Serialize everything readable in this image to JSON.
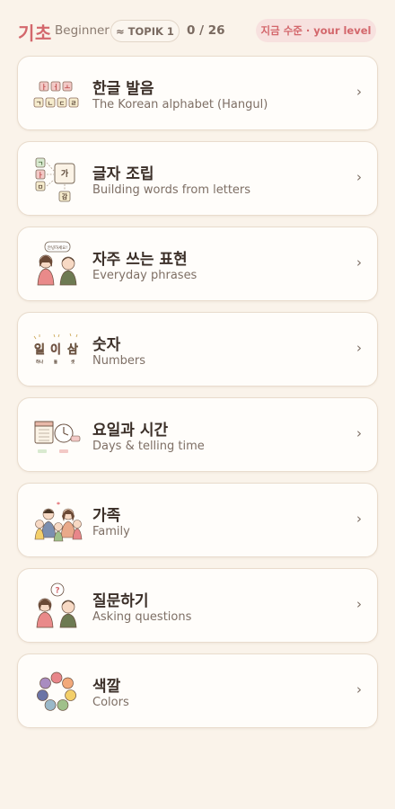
{
  "header": {
    "title": "기초",
    "subtitle": "Beginner",
    "badge": "≈ TOPIK 1",
    "progress": "0 / 26",
    "level_button": "지금 수준 · your level"
  },
  "chevron": "›",
  "lessons": [
    {
      "title_ko": "한글 발음",
      "title_en": "The Korean alphabet (Hangul)",
      "icon": "hangul-tiles-icon"
    },
    {
      "title_ko": "글자 조립",
      "title_en": "Building words from letters",
      "icon": "letter-assembly-icon"
    },
    {
      "title_ko": "자주 쓰는 표현",
      "title_en": "Everyday phrases",
      "icon": "greeting-people-icon"
    },
    {
      "title_ko": "숫자",
      "title_en": "Numbers",
      "icon": "numbers-icon"
    },
    {
      "title_ko": "요일과 시간",
      "title_en": "Days & telling time",
      "icon": "calendar-clock-icon"
    },
    {
      "title_ko": "가족",
      "title_en": "Family",
      "icon": "family-icon"
    },
    {
      "title_ko": "질문하기",
      "title_en": "Asking questions",
      "icon": "question-people-icon"
    },
    {
      "title_ko": "색깔",
      "title_en": "Colors",
      "icon": "color-palette-icon"
    }
  ],
  "illustration_text": {
    "hangul_top": [
      "ㅏ",
      "ㅓ",
      "ㅗ"
    ],
    "hangul_bottom": [
      "ㄱ",
      "ㄴ",
      "ㄷ",
      "ㄹ"
    ],
    "assembly_tiles": [
      "ㄱ",
      "ㅏ",
      "ㅁ",
      "가",
      "감"
    ],
    "speech_bubble": "안녕하세요!",
    "numbers_big": [
      "일",
      "이",
      "삼"
    ],
    "numbers_small": [
      "하나",
      "둘",
      "셋"
    ],
    "question_mark": "?"
  },
  "colors": {
    "accent": "#d3676c",
    "background": "#faf3ea",
    "card": "#fffdfa",
    "palette": [
      "#e8868a",
      "#f2a97a",
      "#f3cf6a",
      "#9fc08a",
      "#9ab8c9",
      "#6b74a6",
      "#a98cc0"
    ]
  }
}
